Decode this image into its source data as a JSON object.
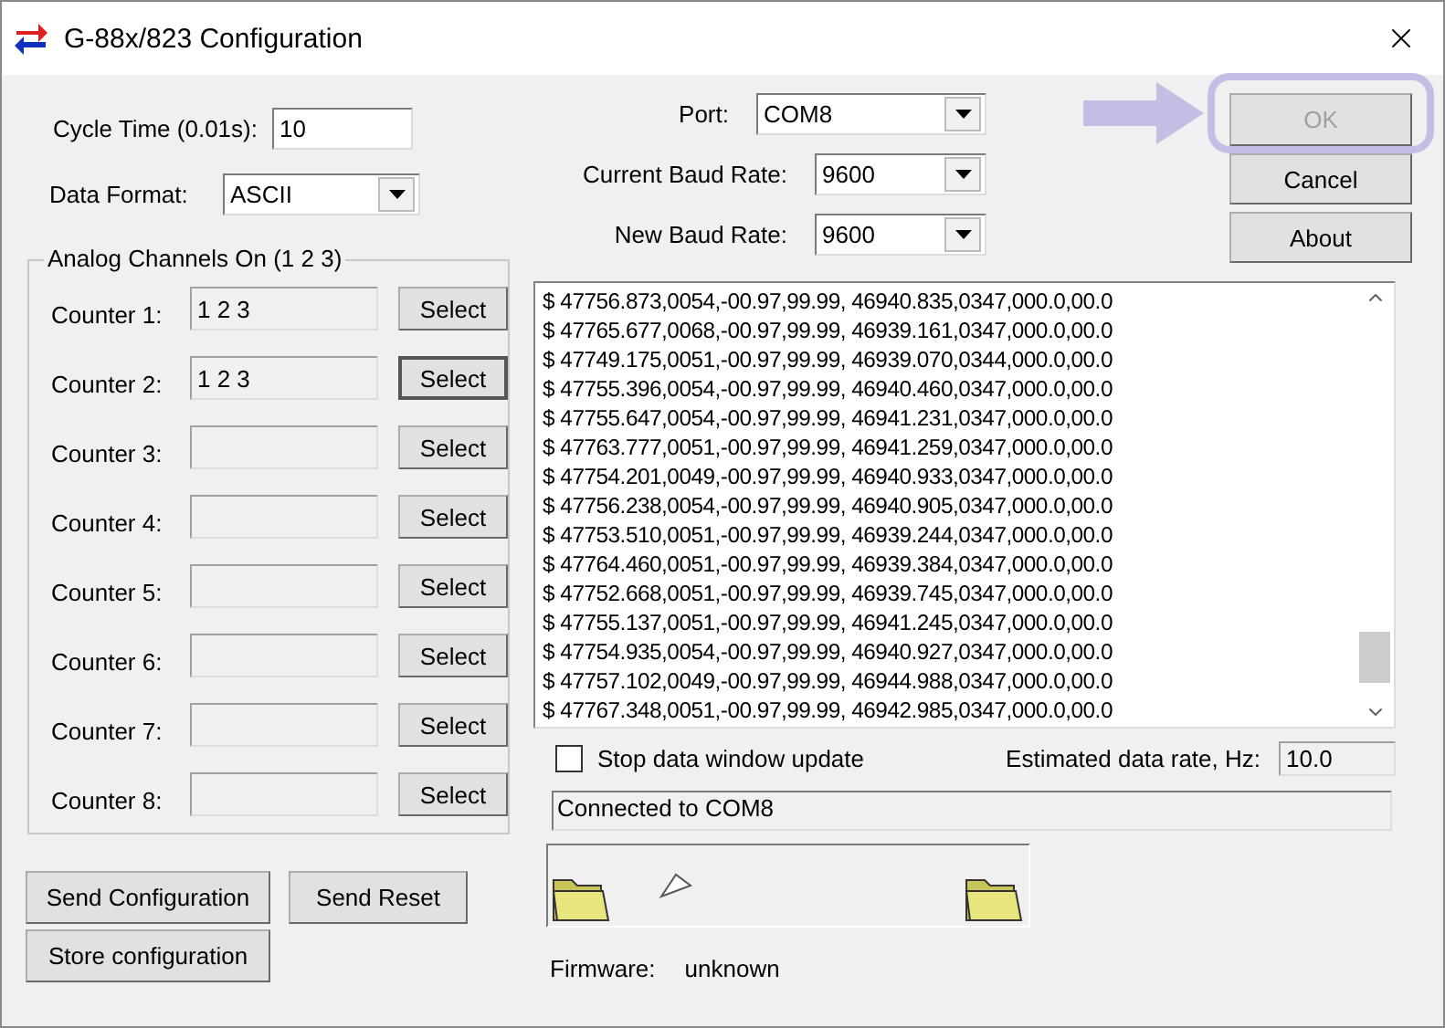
{
  "window": {
    "title": "G-88x/823 Configuration"
  },
  "cycle_time": {
    "label": "Cycle Time (0.01s):",
    "value": "10"
  },
  "data_format": {
    "label": "Data Format:",
    "value": "ASCII"
  },
  "analog_channels": {
    "title": "Analog Channels On (1 2 3)",
    "counters": [
      {
        "label": "Counter 1:",
        "value": "1 2 3",
        "button": "Select",
        "focused": false
      },
      {
        "label": "Counter 2:",
        "value": "1 2 3",
        "button": "Select",
        "focused": true
      },
      {
        "label": "Counter 3:",
        "button": "Select",
        "focused": false
      },
      {
        "label": "Counter 4:",
        "button": "Select",
        "focused": false
      },
      {
        "label": "Counter 5:",
        "button": "Select",
        "focused": false
      },
      {
        "label": "Counter 6:",
        "button": "Select",
        "focused": false
      },
      {
        "label": "Counter 7:",
        "button": "Select",
        "focused": false
      },
      {
        "label": "Counter 8:",
        "button": "Select",
        "focused": false
      }
    ]
  },
  "left_buttons": [
    {
      "label": "Send Configuration"
    },
    {
      "label": "Send Reset"
    },
    {
      "label": "Store configuration"
    }
  ],
  "port": {
    "label": "Port:",
    "value": "COM8"
  },
  "current_baud": {
    "label": "Current Baud Rate:",
    "value": "9600"
  },
  "new_baud": {
    "label": "New Baud Rate:",
    "value": "9600"
  },
  "dialog_buttons": [
    {
      "label": "OK",
      "disabled": true,
      "highlighted": true
    },
    {
      "label": "Cancel",
      "disabled": false,
      "highlighted": false
    },
    {
      "label": "About",
      "disabled": false,
      "highlighted": false
    }
  ],
  "log": {
    "lines": [
      "$ 47756.873,0054,-00.97,99.99, 46940.835,0347,000.0,00.0",
      "$ 47765.677,0068,-00.97,99.99, 46939.161,0347,000.0,00.0",
      "$ 47749.175,0051,-00.97,99.99, 46939.070,0344,000.0,00.0",
      "$ 47755.396,0054,-00.97,99.99, 46940.460,0347,000.0,00.0",
      "$ 47755.647,0054,-00.97,99.99, 46941.231,0347,000.0,00.0",
      "$ 47763.777,0051,-00.97,99.99, 46941.259,0347,000.0,00.0",
      "$ 47754.201,0049,-00.97,99.99, 46940.933,0347,000.0,00.0",
      "$ 47756.238,0054,-00.97,99.99, 46940.905,0347,000.0,00.0",
      "$ 47753.510,0051,-00.97,99.99, 46939.244,0347,000.0,00.0",
      "$ 47764.460,0051,-00.97,99.99, 46939.384,0347,000.0,00.0",
      "$ 47752.668,0051,-00.97,99.99, 46939.745,0347,000.0,00.0",
      "$ 47755.137,0051,-00.97,99.99, 46941.245,0347,000.0,00.0",
      "$ 47754.935,0054,-00.97,99.99, 46940.927,0347,000.0,00.0",
      "$ 47757.102,0049,-00.97,99.99, 46944.988,0347,000.0,00.0",
      "$ 47767.348,0051,-00.97,99.99, 46942.985,0347,000.0,00.0"
    ]
  },
  "stop_update": {
    "label": "Stop data window update",
    "checked": false
  },
  "data_rate": {
    "label": "Estimated data rate, Hz:",
    "value": "10.0"
  },
  "status": "Connected to COM8",
  "firmware": {
    "label": "Firmware:",
    "value": "unknown"
  }
}
